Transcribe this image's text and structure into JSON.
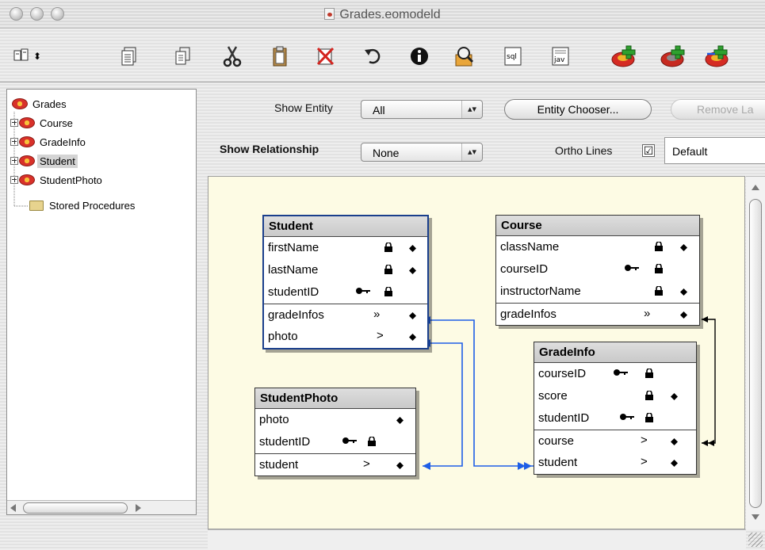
{
  "window": {
    "title": "Grades.eomodeld"
  },
  "toolbar": {
    "icons": [
      "view-mode-icon",
      "new-icon",
      "copy-icon",
      "cut-icon",
      "paste-icon",
      "delete-icon",
      "undo-icon",
      "info-icon",
      "inspect-icon",
      "sql-icon",
      "java-icon",
      "add-entity-icon",
      "add-attribute-icon",
      "add-relationship-icon"
    ]
  },
  "outline": {
    "root": "Grades",
    "items": [
      {
        "label": "Course",
        "expandable": true,
        "selected": false
      },
      {
        "label": "GradeInfo",
        "expandable": true,
        "selected": false
      },
      {
        "label": "Student",
        "expandable": true,
        "selected": true
      },
      {
        "label": "StudentPhoto",
        "expandable": true,
        "selected": false
      }
    ],
    "stored_procedures": "Stored Procedures"
  },
  "controls": {
    "show_entity_label": "Show Entity",
    "show_entity_value": "All",
    "entity_chooser": "Entity Chooser...",
    "remove_button": "Remove La",
    "show_relationship_label": "Show Relationship",
    "show_relationship_value": "None",
    "ortho_lines_label": "Ortho Lines",
    "ortho_lines_checked": true,
    "checkbox_mark": "☑",
    "default_field": "Default"
  },
  "diagram": {
    "entities": {
      "student": {
        "name": "Student",
        "attributes": [
          {
            "name": "firstName",
            "key": false,
            "lock": true,
            "diamond": true
          },
          {
            "name": "lastName",
            "key": false,
            "lock": true,
            "diamond": true
          },
          {
            "name": "studentID",
            "key": true,
            "lock": true,
            "diamond": false
          }
        ],
        "relationships": [
          {
            "name": "gradeInfos",
            "symbol": "»",
            "diamond": true
          },
          {
            "name": "photo",
            "symbol": ">",
            "diamond": true
          }
        ]
      },
      "course": {
        "name": "Course",
        "attributes": [
          {
            "name": "className",
            "key": false,
            "lock": true,
            "diamond": true
          },
          {
            "name": "courseID",
            "key": true,
            "lock": true,
            "diamond": false
          },
          {
            "name": "instructorName",
            "key": false,
            "lock": true,
            "diamond": true
          }
        ],
        "relationships": [
          {
            "name": "gradeInfos",
            "symbol": "»",
            "diamond": true
          }
        ]
      },
      "gradeinfo": {
        "name": "GradeInfo",
        "attributes": [
          {
            "name": "courseID",
            "key": true,
            "lock": true,
            "diamond": false
          },
          {
            "name": "score",
            "key": false,
            "lock": true,
            "diamond": true
          },
          {
            "name": "studentID",
            "key": true,
            "lock": true,
            "diamond": false
          }
        ],
        "relationships": [
          {
            "name": "course",
            "symbol": ">",
            "diamond": true
          },
          {
            "name": "student",
            "symbol": ">",
            "diamond": true
          }
        ]
      },
      "studentphoto": {
        "name": "StudentPhoto",
        "attributes": [
          {
            "name": "photo",
            "key": false,
            "lock": false,
            "diamond": true
          },
          {
            "name": "studentID",
            "key": true,
            "lock": true,
            "diamond": false
          }
        ],
        "relationships": [
          {
            "name": "student",
            "symbol": ">",
            "diamond": true
          }
        ]
      }
    },
    "colors": {
      "canvas": "#fdfbe4",
      "connector_blue": "#1e5ee6",
      "connector_black": "#000000",
      "selection": "#1a3f8c"
    }
  }
}
